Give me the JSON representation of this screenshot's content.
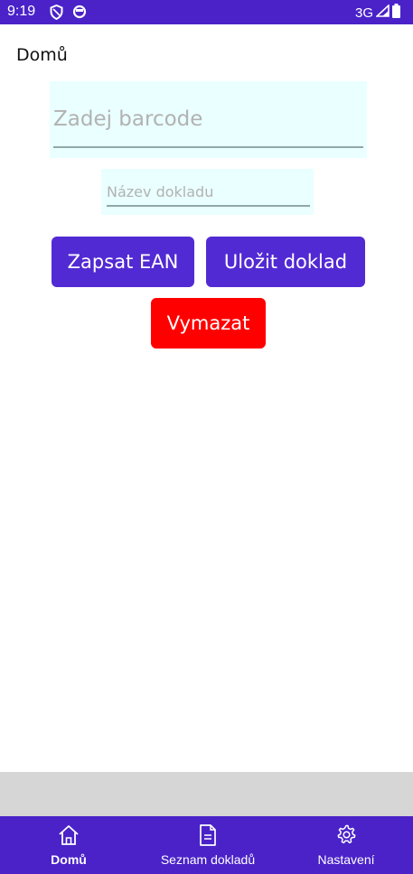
{
  "status_bar": {
    "time": "9:19",
    "network": "3G",
    "icons": [
      "shield-icon",
      "circle-icon",
      "signal-icon",
      "battery-icon"
    ]
  },
  "page": {
    "title": "Domů"
  },
  "barcode_field": {
    "placeholder": "Zadej barcode",
    "value": ""
  },
  "document_name_field": {
    "placeholder": "Název dokladu",
    "value": ""
  },
  "buttons": {
    "write_ean": "Zapsat EAN",
    "save_document": "Uložit doklad",
    "clear": "Vymazat"
  },
  "bottom_nav": {
    "items": [
      {
        "label": "Domů",
        "icon": "home-icon",
        "active": true
      },
      {
        "label": "Seznam dokladů",
        "icon": "document-icon",
        "active": false
      },
      {
        "label": "Nastavení",
        "icon": "gear-icon",
        "active": false
      }
    ]
  },
  "colors": {
    "accent": "#4a22c8",
    "button_purple": "#522ad3",
    "button_red": "#ff0000",
    "field_background": "#eaffff",
    "band_gray": "#d6d6d6"
  }
}
